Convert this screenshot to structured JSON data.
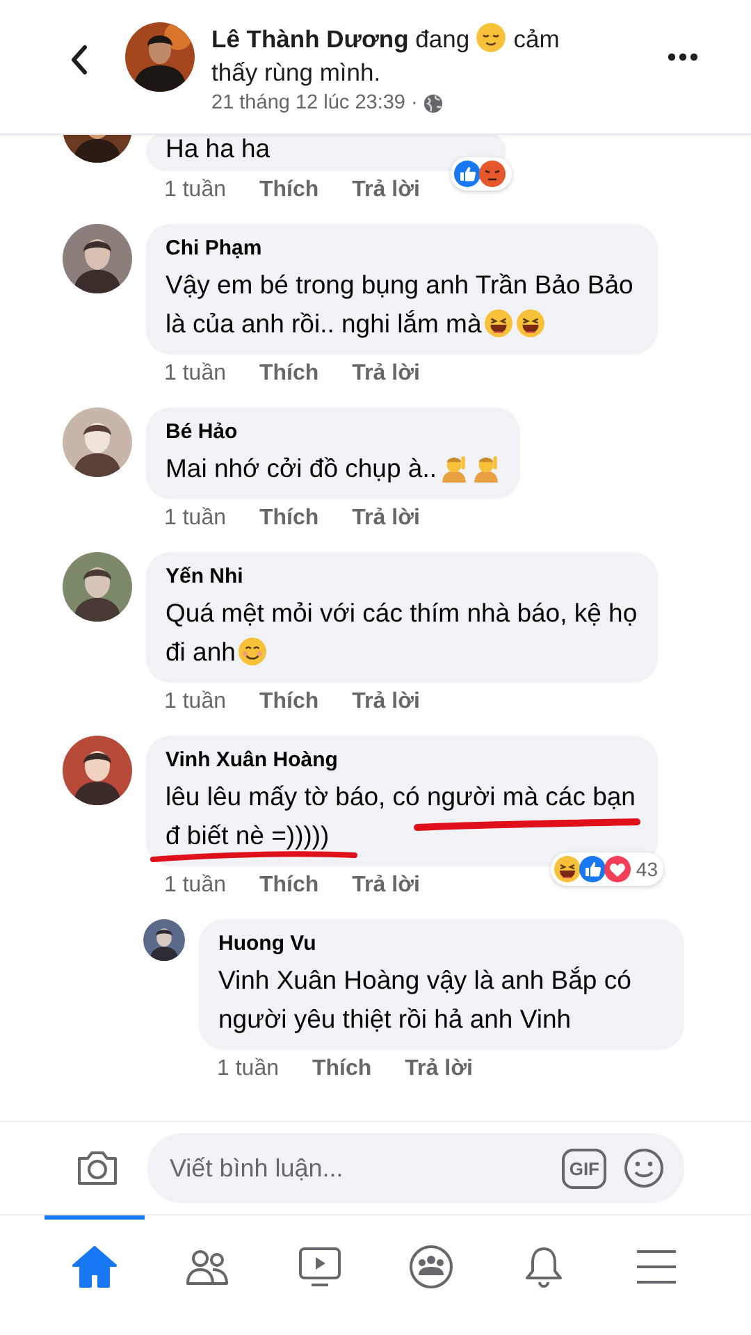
{
  "header": {
    "author": "Lê Thành Dương",
    "activity_before": "đang",
    "mood_icon": {
      "kind": "relieved"
    },
    "activity_after": "cảm thấy rùng mình.",
    "timestamp": "21 tháng 12 lúc 23:39",
    "separator": "·"
  },
  "comments": [
    {
      "kind": "partial",
      "text": "Ha ha ha",
      "age": "1 tuần",
      "like_label": "Thích",
      "reply_label": "Trả lời",
      "reactions": {
        "icons": [
          {
            "kind": "like"
          },
          {
            "kind": "angry"
          }
        ]
      }
    },
    {
      "kind": "comment",
      "name": "Chi Phạm",
      "text": "Vậy em bé trong bụng anh Trần Bảo Bảo là của anh rồi.. nghi lắm mà",
      "trailing_icons": [
        {
          "kind": "laugh"
        },
        {
          "kind": "laugh"
        }
      ],
      "age": "1 tuần",
      "like_label": "Thích",
      "reply_label": "Trả lời"
    },
    {
      "kind": "comment",
      "name": "Bé Hảo",
      "text": "Mai nhớ cởi đồ chụp à..",
      "trailing_icons": [
        {
          "kind": "figure"
        },
        {
          "kind": "figure"
        }
      ],
      "age": "1 tuần",
      "like_label": "Thích",
      "reply_label": "Trả lời"
    },
    {
      "kind": "comment",
      "name": "Yến Nhi",
      "text": "Quá mệt mỏi với các thím nhà báo, kệ họ đi anh",
      "trailing_icons": [
        {
          "kind": "smile"
        }
      ],
      "age": "1 tuần",
      "like_label": "Thích",
      "reply_label": "Trả lời"
    },
    {
      "kind": "comment",
      "name": "Vinh Xuân Hoàng",
      "text": "lêu lêu mấy tờ báo, có người mà các bạn đ biết nè =)))))",
      "underlined": true,
      "age": "1 tuần",
      "like_label": "Thích",
      "reply_label": "Trả lời",
      "reactions": {
        "icons": [
          {
            "kind": "haha"
          },
          {
            "kind": "like"
          },
          {
            "kind": "love"
          }
        ],
        "count": "43"
      }
    },
    {
      "kind": "reply",
      "name": "Huong Vu",
      "text": "Vinh Xuân Hoàng vậy là anh Bắp có người yêu thiệt rồi hả anh Vinh",
      "age": "1 tuần",
      "like_label": "Thích",
      "reply_label": "Trả lời"
    }
  ],
  "composer": {
    "placeholder": "Viết bình luận...",
    "gif_label": "GIF"
  },
  "nav": [
    {
      "kind": "home",
      "selected": true
    },
    {
      "kind": "friends",
      "selected": false
    },
    {
      "kind": "watch",
      "selected": false
    },
    {
      "kind": "groups",
      "selected": false
    },
    {
      "kind": "bell",
      "selected": false
    },
    {
      "kind": "menu",
      "selected": false
    }
  ]
}
